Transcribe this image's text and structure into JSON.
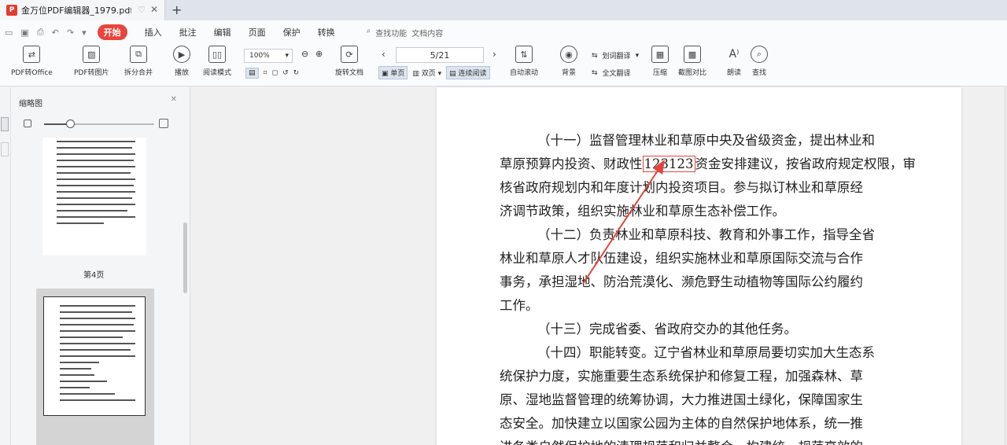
{
  "tab": {
    "title": "金万位PDF编辑器_1979.pdf"
  },
  "menu": {
    "items": [
      "开始",
      "插入",
      "批注",
      "编辑",
      "页面",
      "保护",
      "转换"
    ],
    "search_hint": "查找功能",
    "search_hint2": "文档内容"
  },
  "ribbon": {
    "pdf_to_office": "PDF转Office",
    "pdf_to_image": "PDF转图片",
    "split_merge": "拆分合并",
    "play": "播放",
    "read_mode": "阅读模式",
    "zoom": "100%",
    "rotate_doc": "旋转文档",
    "single_page": "单页",
    "double_page": "双页",
    "continuous": "连续阅读",
    "auto_scroll": "自动滚动",
    "page_value": "5/21",
    "background": "背景",
    "full_translate": "全文翻译",
    "translate_sel": "划词翻译",
    "compress": "压缩",
    "screenshot_compare": "截图对比",
    "read_aloud": "朗读",
    "find": "查找"
  },
  "sidebar": {
    "title": "缩略图",
    "thumb_label": "第4页"
  },
  "document": {
    "lines": [
      "（十一）监督管理林业和草原中央及省级资金，提出林业和",
      "草原预算内投资、财政性",
      "资金安排建议，按省政府规定权限，审",
      "核省政府规划内和年度计划内投资项目。参与拟订林业和草原经",
      "济调节政策，组织实施林业和草原生态补偿工作。",
      "（十二）负责林业和草原科技、教育和外事工作，指导全省",
      "林业和草原人才队伍建设，组织实施林业和草原国际交流与合作",
      "事务，承担湿地、防治荒漠化、濒危野生动植物等国际公约履约",
      "工作。",
      "（十三）完成省委、省政府交办的其他任务。",
      "（十四）职能转变。辽宁省林业和草原局要切实加大生态系",
      "统保护力度，实施重要生态系统保护和修复工程，加强森林、草",
      "原、湿地监督管理的统筹协调，大力推进国土绿化，保障国家生",
      "态安全。加快建立以国家公园为主体的自然保护地体系，统一推",
      "进各类自然保护地的清理规范和归并整合，构建统一规范高效的"
    ],
    "highlight": "123123"
  },
  "colors": {
    "accent": "#e8453c",
    "annotation": "#e0453c"
  }
}
